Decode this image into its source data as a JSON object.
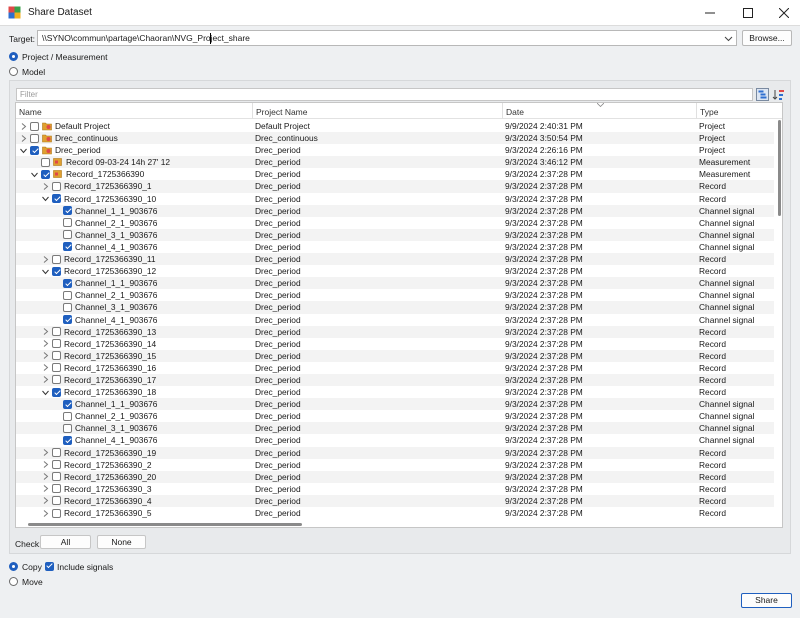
{
  "window": {
    "title": "Share Dataset"
  },
  "target": {
    "label": "Target:",
    "value": "\\\\SYNO\\commun\\partage\\Chaoran\\NVG_Project_share",
    "browse_label": "Browse..."
  },
  "source_mode": {
    "options": [
      "Project / Measurement",
      "Model"
    ],
    "selected": "Project / Measurement"
  },
  "filter": {
    "placeholder": "Filter"
  },
  "table": {
    "columns": [
      "Name",
      "Project Name",
      "Date",
      "Type"
    ],
    "rows": [
      {
        "name": "Default Project",
        "project": "Default Project",
        "date": "9/9/2024 2:40:31 PM",
        "type": "Project",
        "depth": 0,
        "expander": "collapsed",
        "checked": false,
        "icon": "project-icon"
      },
      {
        "name": "Drec_continuous",
        "project": "Drec_continuous",
        "date": "9/3/2024 3:50:54 PM",
        "type": "Project",
        "depth": 0,
        "expander": "collapsed",
        "checked": false,
        "icon": "project-icon"
      },
      {
        "name": "Drec_period",
        "project": "Drec_period",
        "date": "9/3/2024 2:26:16 PM",
        "type": "Project",
        "depth": 0,
        "expander": "expanded",
        "checked": true,
        "icon": "project-icon"
      },
      {
        "name": "Record 09-03-24 14h 27' 12",
        "project": "Drec_period",
        "date": "9/3/2024 3:46:12 PM",
        "type": "Measurement",
        "depth": 1,
        "expander": "none",
        "checked": false,
        "icon": "measurement-icon"
      },
      {
        "name": "Record_1725366390",
        "project": "Drec_period",
        "date": "9/3/2024 2:37:28 PM",
        "type": "Measurement",
        "depth": 1,
        "expander": "expanded",
        "checked": true,
        "icon": "measurement-icon"
      },
      {
        "name": "Record_1725366390_1",
        "project": "Drec_period",
        "date": "9/3/2024 2:37:28 PM",
        "type": "Record",
        "depth": 2,
        "expander": "collapsed",
        "checked": false,
        "icon": ""
      },
      {
        "name": "Record_1725366390_10",
        "project": "Drec_period",
        "date": "9/3/2024 2:37:28 PM",
        "type": "Record",
        "depth": 2,
        "expander": "expanded",
        "checked": true,
        "icon": ""
      },
      {
        "name": "Channel_1_1_903676",
        "project": "Drec_period",
        "date": "9/3/2024 2:37:28 PM",
        "type": "Channel signal",
        "depth": 3,
        "expander": "none",
        "checked": true,
        "icon": ""
      },
      {
        "name": "Channel_2_1_903676",
        "project": "Drec_period",
        "date": "9/3/2024 2:37:28 PM",
        "type": "Channel signal",
        "depth": 3,
        "expander": "none",
        "checked": false,
        "icon": ""
      },
      {
        "name": "Channel_3_1_903676",
        "project": "Drec_period",
        "date": "9/3/2024 2:37:28 PM",
        "type": "Channel signal",
        "depth": 3,
        "expander": "none",
        "checked": false,
        "icon": ""
      },
      {
        "name": "Channel_4_1_903676",
        "project": "Drec_period",
        "date": "9/3/2024 2:37:28 PM",
        "type": "Channel signal",
        "depth": 3,
        "expander": "none",
        "checked": true,
        "icon": ""
      },
      {
        "name": "Record_1725366390_11",
        "project": "Drec_period",
        "date": "9/3/2024 2:37:28 PM",
        "type": "Record",
        "depth": 2,
        "expander": "collapsed",
        "checked": false,
        "icon": ""
      },
      {
        "name": "Record_1725366390_12",
        "project": "Drec_period",
        "date": "9/3/2024 2:37:28 PM",
        "type": "Record",
        "depth": 2,
        "expander": "expanded",
        "checked": true,
        "icon": ""
      },
      {
        "name": "Channel_1_1_903676",
        "project": "Drec_period",
        "date": "9/3/2024 2:37:28 PM",
        "type": "Channel signal",
        "depth": 3,
        "expander": "none",
        "checked": true,
        "icon": ""
      },
      {
        "name": "Channel_2_1_903676",
        "project": "Drec_period",
        "date": "9/3/2024 2:37:28 PM",
        "type": "Channel signal",
        "depth": 3,
        "expander": "none",
        "checked": false,
        "icon": ""
      },
      {
        "name": "Channel_3_1_903676",
        "project": "Drec_period",
        "date": "9/3/2024 2:37:28 PM",
        "type": "Channel signal",
        "depth": 3,
        "expander": "none",
        "checked": false,
        "icon": ""
      },
      {
        "name": "Channel_4_1_903676",
        "project": "Drec_period",
        "date": "9/3/2024 2:37:28 PM",
        "type": "Channel signal",
        "depth": 3,
        "expander": "none",
        "checked": true,
        "icon": ""
      },
      {
        "name": "Record_1725366390_13",
        "project": "Drec_period",
        "date": "9/3/2024 2:37:28 PM",
        "type": "Record",
        "depth": 2,
        "expander": "collapsed",
        "checked": false,
        "icon": ""
      },
      {
        "name": "Record_1725366390_14",
        "project": "Drec_period",
        "date": "9/3/2024 2:37:28 PM",
        "type": "Record",
        "depth": 2,
        "expander": "collapsed",
        "checked": false,
        "icon": ""
      },
      {
        "name": "Record_1725366390_15",
        "project": "Drec_period",
        "date": "9/3/2024 2:37:28 PM",
        "type": "Record",
        "depth": 2,
        "expander": "collapsed",
        "checked": false,
        "icon": ""
      },
      {
        "name": "Record_1725366390_16",
        "project": "Drec_period",
        "date": "9/3/2024 2:37:28 PM",
        "type": "Record",
        "depth": 2,
        "expander": "collapsed",
        "checked": false,
        "icon": ""
      },
      {
        "name": "Record_1725366390_17",
        "project": "Drec_period",
        "date": "9/3/2024 2:37:28 PM",
        "type": "Record",
        "depth": 2,
        "expander": "collapsed",
        "checked": false,
        "icon": ""
      },
      {
        "name": "Record_1725366390_18",
        "project": "Drec_period",
        "date": "9/3/2024 2:37:28 PM",
        "type": "Record",
        "depth": 2,
        "expander": "expanded",
        "checked": true,
        "icon": ""
      },
      {
        "name": "Channel_1_1_903676",
        "project": "Drec_period",
        "date": "9/3/2024 2:37:28 PM",
        "type": "Channel signal",
        "depth": 3,
        "expander": "none",
        "checked": true,
        "icon": ""
      },
      {
        "name": "Channel_2_1_903676",
        "project": "Drec_period",
        "date": "9/3/2024 2:37:28 PM",
        "type": "Channel signal",
        "depth": 3,
        "expander": "none",
        "checked": false,
        "icon": ""
      },
      {
        "name": "Channel_3_1_903676",
        "project": "Drec_period",
        "date": "9/3/2024 2:37:28 PM",
        "type": "Channel signal",
        "depth": 3,
        "expander": "none",
        "checked": false,
        "icon": ""
      },
      {
        "name": "Channel_4_1_903676",
        "project": "Drec_period",
        "date": "9/3/2024 2:37:28 PM",
        "type": "Channel signal",
        "depth": 3,
        "expander": "none",
        "checked": true,
        "icon": ""
      },
      {
        "name": "Record_1725366390_19",
        "project": "Drec_period",
        "date": "9/3/2024 2:37:28 PM",
        "type": "Record",
        "depth": 2,
        "expander": "collapsed",
        "checked": false,
        "icon": ""
      },
      {
        "name": "Record_1725366390_2",
        "project": "Drec_period",
        "date": "9/3/2024 2:37:28 PM",
        "type": "Record",
        "depth": 2,
        "expander": "collapsed",
        "checked": false,
        "icon": ""
      },
      {
        "name": "Record_1725366390_20",
        "project": "Drec_period",
        "date": "9/3/2024 2:37:28 PM",
        "type": "Record",
        "depth": 2,
        "expander": "collapsed",
        "checked": false,
        "icon": ""
      },
      {
        "name": "Record_1725366390_3",
        "project": "Drec_period",
        "date": "9/3/2024 2:37:28 PM",
        "type": "Record",
        "depth": 2,
        "expander": "collapsed",
        "checked": false,
        "icon": ""
      },
      {
        "name": "Record_1725366390_4",
        "project": "Drec_period",
        "date": "9/3/2024 2:37:28 PM",
        "type": "Record",
        "depth": 2,
        "expander": "collapsed",
        "checked": false,
        "icon": ""
      },
      {
        "name": "Record_1725366390_5",
        "project": "Drec_period",
        "date": "9/3/2024 2:37:28 PM",
        "type": "Record",
        "depth": 2,
        "expander": "collapsed",
        "checked": false,
        "icon": ""
      }
    ]
  },
  "check": {
    "label": "Check:",
    "all_label": "All",
    "none_label": "None"
  },
  "operation": {
    "options": [
      "Copy",
      "Move"
    ],
    "selected": "Copy",
    "include_signals_label": "Include signals",
    "include_signals_checked": true
  },
  "share_label": "Share",
  "colors": {
    "accent": "#1f5fbf",
    "folder": "#e0a030",
    "panel": "#e8eaec"
  }
}
